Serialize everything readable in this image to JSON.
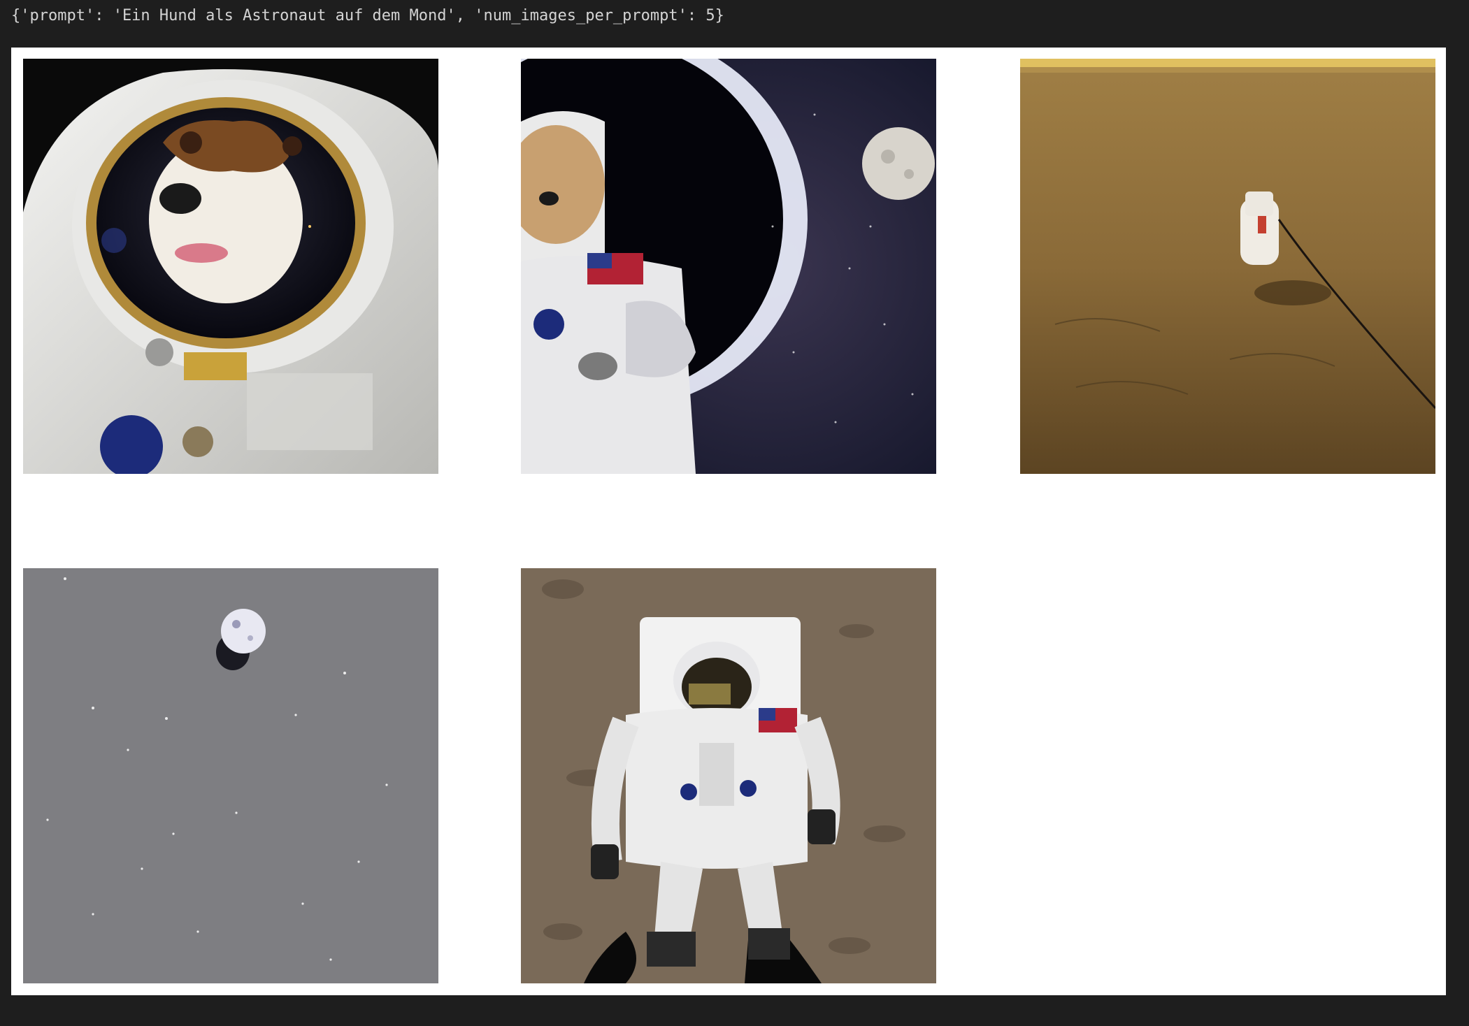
{
  "cell_output": {
    "text": "{'prompt': 'Ein Hund als Astronaut auf dem Mond', 'num_images_per_prompt': 5}"
  },
  "images": [
    {
      "label": "dog-astronaut-helmet-closeup"
    },
    {
      "label": "dog-astronaut-in-space"
    },
    {
      "label": "astronaut-on-desert-surface"
    },
    {
      "label": "moon-in-grey-starfield"
    },
    {
      "label": "astronaut-lying-on-moon-surface"
    }
  ],
  "colors": {
    "page_bg": "#1e1e1e",
    "canvas_bg": "#ffffff",
    "text": "#d4d4d4"
  }
}
